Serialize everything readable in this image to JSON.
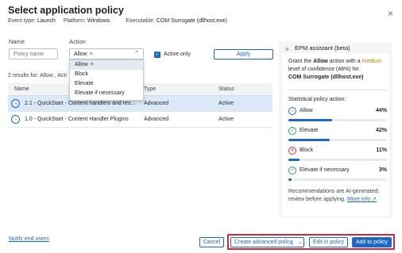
{
  "dialog": {
    "title": "Select application policy",
    "close": "×",
    "meta": {
      "event_type_label": "Event type:",
      "event_type_value": "Launch",
      "platform_label": "Platform:",
      "platform_value": "Windows",
      "executable_label": "Executable:",
      "executable_value": "COM Surrogate (dllhost.exe)"
    }
  },
  "filters": {
    "name_label": "Name",
    "name_placeholder": "Policy name",
    "action_label": "Action",
    "action_selected": "Allow",
    "action_selected_icon": "✧",
    "action_options": [
      "Allow",
      "Block",
      "Elevate",
      "Elevate if necessary"
    ],
    "active_only_label": "Active only",
    "active_only_checked": true,
    "apply_label": "Apply"
  },
  "results_text": "2 results  for: Allow , Acti",
  "table": {
    "columns": [
      "Name",
      "Type",
      "Status"
    ],
    "rows": [
      {
        "name": "2.1 - QuickStart - Content handlers and res...",
        "type": "Advanced",
        "status": "Active",
        "selected": true
      },
      {
        "name": "1.0 - QuickStart - Content Handler Plugins",
        "type": "Advanced",
        "status": "Active",
        "selected": false
      }
    ]
  },
  "assistant": {
    "title": "EPM assistant (beta)",
    "grant_pre": "Grant the ",
    "grant_action": "Allow",
    "grant_mid": " action with a ",
    "grant_level": "medium",
    "grant_post": " level of confidence (48%) for",
    "grant_target": "COM Surrogate (dllhost.exe)",
    "stat_header": "Statistical policy action:",
    "stats": [
      {
        "name": "Allow",
        "pct": "44%",
        "value": 44,
        "icon": "→",
        "color": "#1d67c7"
      },
      {
        "name": "Elevate",
        "pct": "42%",
        "value": 42,
        "icon": "✓",
        "color": "#2e9e4f"
      },
      {
        "name": "Block",
        "pct": "11%",
        "value": 11,
        "icon": "✕",
        "color": "#d5283c"
      },
      {
        "name": "Elevate if necessary",
        "pct": "3%",
        "value": 3,
        "icon": "✓",
        "color": "#2e9e4f"
      }
    ],
    "disclaimer": "Recommendations are AI-generated; review before applying.",
    "more_info": "More info ↗"
  },
  "footer": {
    "notify": "Notify end users",
    "cancel": "Cancel",
    "create_advanced": "Create advanced policy",
    "edit_policy": "Edit in policy",
    "add_policy": "Add to policy"
  }
}
